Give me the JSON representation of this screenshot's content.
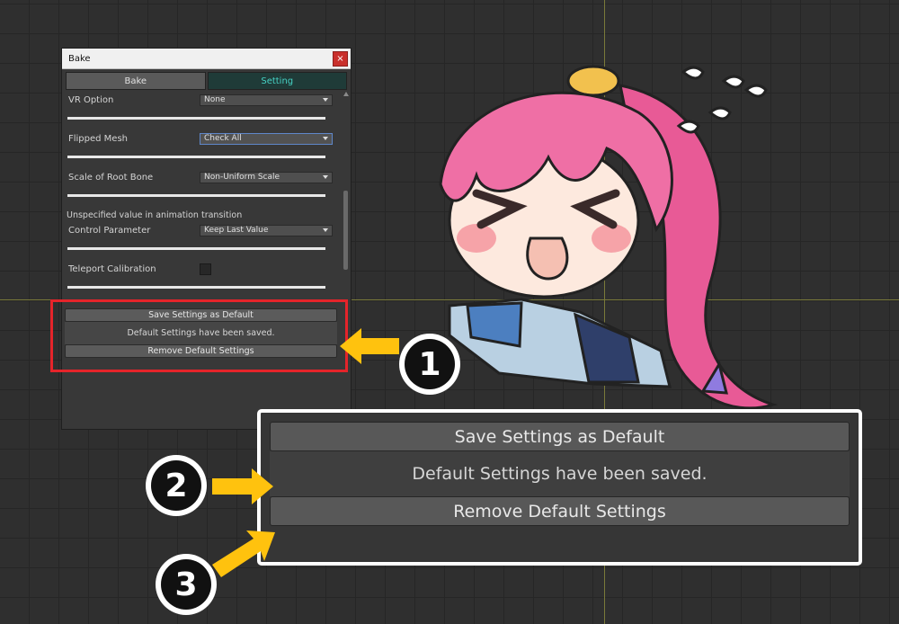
{
  "window": {
    "title": "Bake",
    "close_glyph": "×",
    "tabs": [
      {
        "label": "Bake",
        "active": false
      },
      {
        "label": "Setting",
        "active": true
      }
    ]
  },
  "settings": {
    "vr_option": {
      "label": "VR Option",
      "value": "None"
    },
    "flipped_mesh": {
      "label": "Flipped Mesh",
      "value": "Check All"
    },
    "scale_root_bone": {
      "label": "Scale of Root Bone",
      "value": "Non-Uniform Scale"
    },
    "transition_note": "Unspecified value in animation transition",
    "control_parameter": {
      "label": "Control Parameter",
      "value": "Keep Last Value"
    },
    "teleport_calibration": {
      "label": "Teleport Calibration",
      "checked": false
    }
  },
  "default_settings": {
    "save_button": "Save Settings as Default",
    "message": "Default Settings have been saved.",
    "remove_button": "Remove Default Settings"
  },
  "callouts": [
    {
      "number": "1"
    },
    {
      "number": "2"
    },
    {
      "number": "3"
    }
  ],
  "colors": {
    "highlight": "#e5242a",
    "arrow": "#ffc20e",
    "setting_tab_text": "#46d1c4"
  }
}
